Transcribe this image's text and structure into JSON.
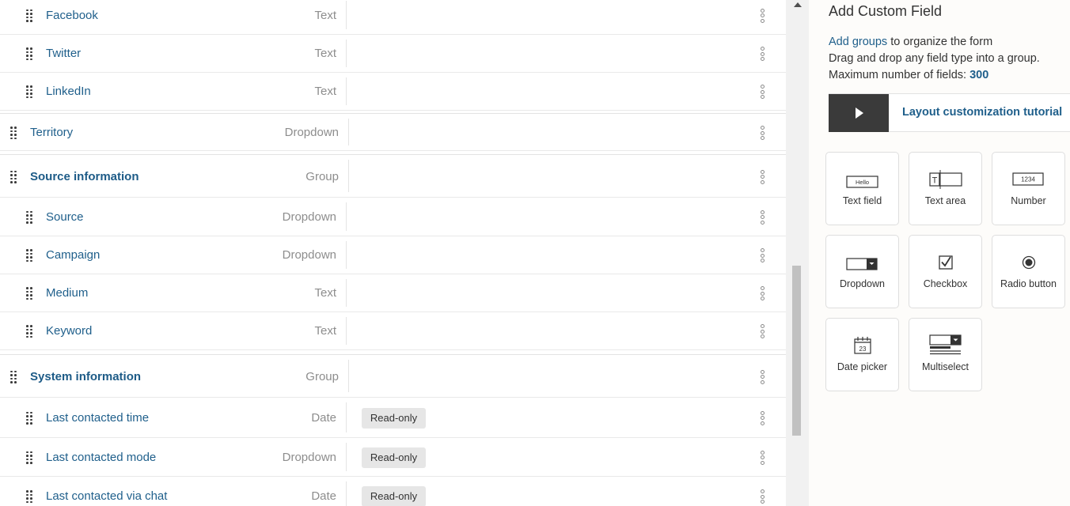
{
  "fields": [
    {
      "name": "Facebook",
      "type": "Text",
      "group": false
    },
    {
      "name": "Twitter",
      "type": "Text",
      "group": false
    },
    {
      "name": "LinkedIn",
      "type": "Text",
      "group": false
    },
    {
      "name": "Territory",
      "type": "Dropdown",
      "group": false
    },
    {
      "name": "Source information",
      "type": "Group",
      "group": true
    },
    {
      "name": "Source",
      "type": "Dropdown",
      "group": false
    },
    {
      "name": "Campaign",
      "type": "Dropdown",
      "group": false
    },
    {
      "name": "Medium",
      "type": "Text",
      "group": false
    },
    {
      "name": "Keyword",
      "type": "Text",
      "group": false
    },
    {
      "name": "System information",
      "type": "Group",
      "group": true
    },
    {
      "name": "Last contacted time",
      "type": "Date",
      "group": false,
      "badge": "Read-only"
    },
    {
      "name": "Last contacted mode",
      "type": "Dropdown",
      "group": false,
      "badge": "Read-only"
    },
    {
      "name": "Last contacted via chat",
      "type": "Date",
      "group": false,
      "badge": "Read-only"
    }
  ],
  "panel": {
    "title": "Add Custom Field",
    "help_link": "Add groups",
    "help_line1_rest": " to organize the form",
    "help_line2": "Drag and drop any field type into a group.",
    "help_line3_label": "Maximum number of fields: ",
    "max_fields": "300",
    "tutorial_label": "Layout customization tutorial",
    "tiles": [
      {
        "label": "Text field",
        "icon": "text-field-icon",
        "icon_text": "Hello"
      },
      {
        "label": "Text area",
        "icon": "text-area-icon",
        "icon_text": "T"
      },
      {
        "label": "Number",
        "icon": "number-icon",
        "icon_text": "1234"
      },
      {
        "label": "Dropdown",
        "icon": "dropdown-icon"
      },
      {
        "label": "Checkbox",
        "icon": "checkbox-icon"
      },
      {
        "label": "Radio button",
        "icon": "radio-button-icon"
      },
      {
        "label": "Date picker",
        "icon": "date-picker-icon",
        "icon_text": "23"
      },
      {
        "label": "Multiselect",
        "icon": "multiselect-icon"
      }
    ]
  },
  "colors": {
    "link": "#1f5f8b",
    "type_text": "#8d8d8d",
    "play_bg": "#3a3a3a"
  }
}
